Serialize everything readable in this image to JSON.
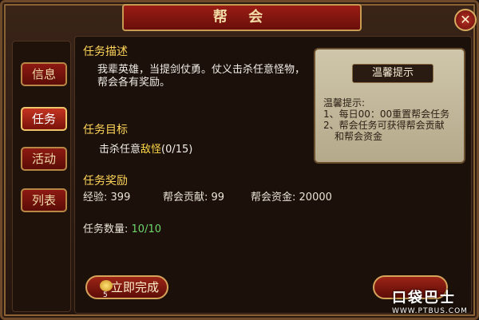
{
  "window": {
    "title": "帮 会",
    "close_label": "✕"
  },
  "sidebar": {
    "items": [
      {
        "label": "信息",
        "active": false
      },
      {
        "label": "任务",
        "active": true
      },
      {
        "label": "活动",
        "active": false
      },
      {
        "label": "列表",
        "active": false
      }
    ]
  },
  "task": {
    "desc_heading": "任务描述",
    "desc_line1": "我辈英雄，当提剑仗勇。仗义击杀任意怪物，",
    "desc_line2": "帮会各有奖励。",
    "goal_heading": "任务目标",
    "goal_prefix": "击杀任意",
    "goal_target": "敌怪",
    "goal_progress": "(0/15)",
    "reward_heading": "任务奖励",
    "reward_exp_label": "经验:",
    "reward_exp_value": "399",
    "reward_contrib_label": "帮会贡献:",
    "reward_contrib_value": "99",
    "reward_funds_label": "帮会资金:",
    "reward_funds_value": "20000",
    "count_label": "任务数量:",
    "count_value": "10/10"
  },
  "tip": {
    "title": "温馨提示",
    "heading": "温馨提示:",
    "line1": "1、每日00：00重置帮会任务",
    "line2": "2、帮会任务可获得帮会贡献",
    "line3": "和帮会资金"
  },
  "actions": {
    "complete_now_label": "立即完成",
    "complete_cost": "5"
  },
  "watermark": {
    "brand": "口袋巴士",
    "site": "WWW.PTBUS.COM"
  },
  "colors": {
    "accent_red": "#8d1a12",
    "gold": "#ffd55a",
    "green": "#6fd66a"
  }
}
